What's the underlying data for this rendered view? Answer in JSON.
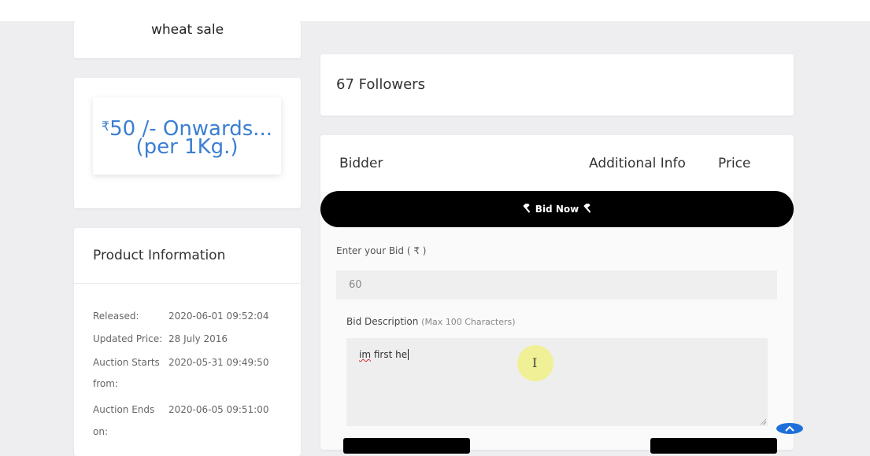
{
  "product": {
    "title": "wheat sale",
    "price_currency": "₹",
    "price_line1": "50 /- Onwards...",
    "price_line2": "(per 1Kg.)"
  },
  "info": {
    "heading": "Product Information",
    "rows": [
      {
        "label": "Released:",
        "value": "2020-06-01 09:52:04"
      },
      {
        "label": "Updated Price:",
        "value": "28 July 2016"
      },
      {
        "label": "Auction Starts",
        "value": "2020-05-31 09:49:50"
      },
      {
        "label": "from:",
        "value": ""
      },
      {
        "label": "Auction Ends",
        "value": "2020-06-05 09:51:00"
      },
      {
        "label": "on:",
        "value": ""
      }
    ]
  },
  "followers": {
    "count": "67",
    "label": "Followers"
  },
  "bids_table": {
    "columns": [
      "Bidder",
      "Additional Info",
      "Price"
    ]
  },
  "bid_form": {
    "bid_now_label": "Bid Now",
    "enter_bid_label": "Enter your Bid ( ₹ )",
    "bid_value": "60",
    "description_label": "Bid Description",
    "description_hint": "(Max 100 Characters)",
    "description_value_underlined": "im",
    "description_value_rest": " first he"
  },
  "colors": {
    "accent_blue": "#3b7fd1",
    "button_black": "#000000",
    "scroll_button": "#1e6fd9"
  }
}
